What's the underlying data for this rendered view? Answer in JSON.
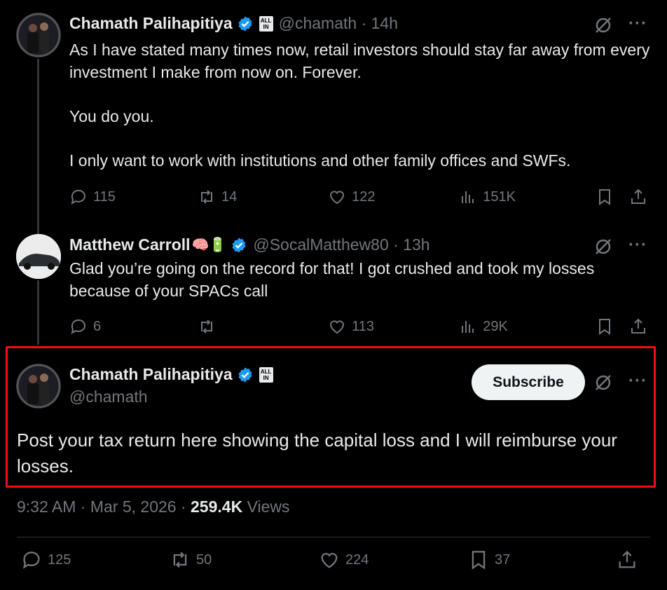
{
  "tweets": [
    {
      "name": "Chamath Palihapitiya",
      "handle": "@chamath · 14h",
      "badge": "ALL IN",
      "text": "As I have stated many times now, retail investors should stay far away from every investment I make from now on. Forever.\n\nYou do you.\n\nI only want to work with institutions and other family offices and SWFs.",
      "replies": "115",
      "reposts": "14",
      "likes": "122",
      "views": "151K"
    },
    {
      "name": "Matthew Carroll",
      "emojis": "🧠🔋",
      "handle": "@SocalMatthew80 · 13h",
      "text": "Glad you’re going on the record for that! I got crushed and took my losses because of your SPACs call",
      "replies": "6",
      "reposts": "",
      "likes": "113",
      "views": "29K"
    }
  ],
  "main_tweet": {
    "name": "Chamath Palihapitiya",
    "handle": "@chamath",
    "badge": "ALL IN",
    "subscribe_label": "Subscribe",
    "text": "Post your tax return here showing the capital loss and I will reimburse your losses.",
    "time": "9:32 AM · Mar 5, 2026 · ",
    "views_count": "259.4K",
    "views_label": " Views",
    "replies": "125",
    "reposts": "50",
    "likes": "224",
    "bookmarks": "37"
  },
  "colors": {
    "background": "#000000",
    "text": "#e7e9ea",
    "muted": "#71767b",
    "verified": "#1d9bf0",
    "highlight": "#ee1111"
  },
  "icons": [
    "verified-icon",
    "reply-icon",
    "repost-icon",
    "like-icon",
    "views-icon",
    "bookmark-icon",
    "share-icon",
    "grok-icon",
    "more-icon"
  ]
}
